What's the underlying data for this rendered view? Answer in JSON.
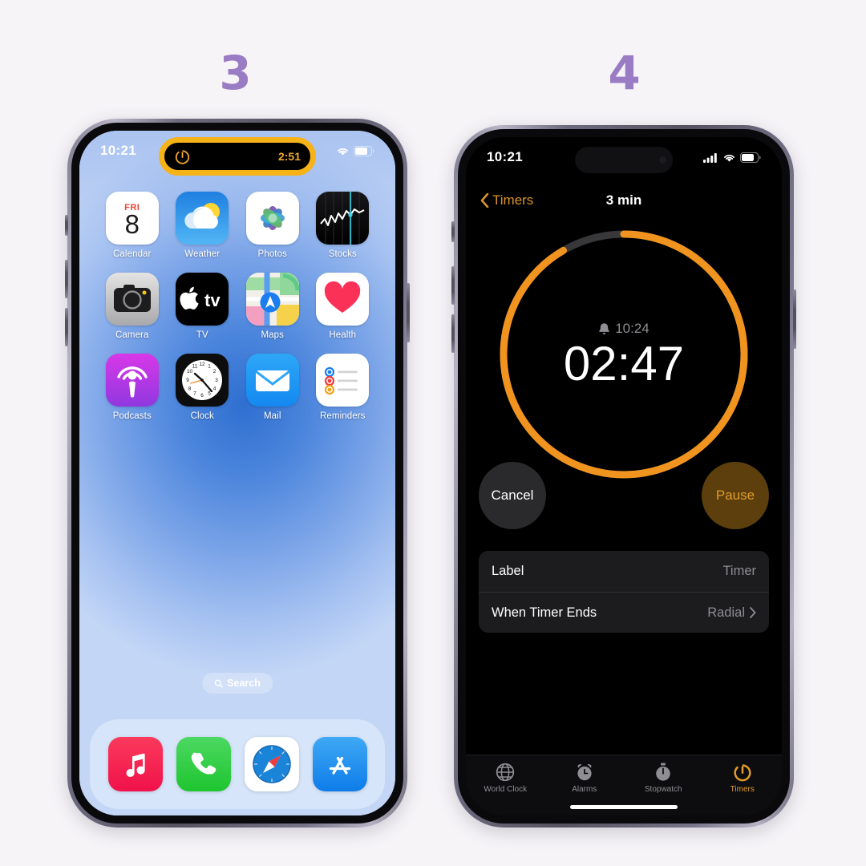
{
  "steps": {
    "left": "3",
    "right": "4",
    "color": "#9a7cc4"
  },
  "left_phone": {
    "status_bar": {
      "time": "10:21",
      "wifi_icon": "wifi-icon",
      "battery_icon": "battery-icon"
    },
    "dynamic_island": {
      "activity_icon": "timer-icon",
      "remaining": "2:51",
      "highlight_color": "#f6b318"
    },
    "apps": [
      {
        "name": "Calendar",
        "icon": "calendar-icon",
        "day_name": "FRI",
        "day_number": "8"
      },
      {
        "name": "Weather",
        "icon": "weather-icon"
      },
      {
        "name": "Photos",
        "icon": "photos-icon"
      },
      {
        "name": "Stocks",
        "icon": "stocks-icon"
      },
      {
        "name": "Camera",
        "icon": "camera-icon"
      },
      {
        "name": "TV",
        "icon": "tv-icon",
        "glyph": "tv"
      },
      {
        "name": "Maps",
        "icon": "maps-icon"
      },
      {
        "name": "Health",
        "icon": "health-icon"
      },
      {
        "name": "Podcasts",
        "icon": "podcasts-icon"
      },
      {
        "name": "Clock",
        "icon": "clock-icon"
      },
      {
        "name": "Mail",
        "icon": "mail-icon"
      },
      {
        "name": "Reminders",
        "icon": "reminders-icon"
      }
    ],
    "search": {
      "label": "Search",
      "icon": "search-icon"
    },
    "dock": [
      {
        "name": "Music",
        "icon": "music-icon"
      },
      {
        "name": "Phone",
        "icon": "phone-icon"
      },
      {
        "name": "Safari",
        "icon": "safari-icon"
      },
      {
        "name": "App Store",
        "icon": "app-store-icon"
      }
    ]
  },
  "right_phone": {
    "status_bar": {
      "time": "10:21",
      "cellular_icon": "cellular-bars-icon",
      "wifi_icon": "wifi-icon",
      "battery_icon": "battery-icon"
    },
    "nav": {
      "back_label": "Timers",
      "back_icon": "chevron-left-icon",
      "title": "3 min"
    },
    "timer": {
      "alarm_icon": "bell-icon",
      "alarm_time": "10:24",
      "remaining": "02:47",
      "progress_color": "#f0941f",
      "track_color": "#38383a",
      "progress_fraction": 0.916
    },
    "controls": {
      "cancel_label": "Cancel",
      "pause_label": "Pause"
    },
    "settings": [
      {
        "label": "Label",
        "value": "Timer",
        "chevron": false
      },
      {
        "label": "When Timer Ends",
        "value": "Radial",
        "chevron": true
      }
    ],
    "tabs": [
      {
        "label": "World Clock",
        "icon": "globe-icon",
        "active": false
      },
      {
        "label": "Alarms",
        "icon": "alarm-icon",
        "active": false
      },
      {
        "label": "Stopwatch",
        "icon": "stopwatch-icon",
        "active": false
      },
      {
        "label": "Timers",
        "icon": "timer-icon",
        "active": true
      }
    ],
    "accent_color": "#e09b2b"
  }
}
